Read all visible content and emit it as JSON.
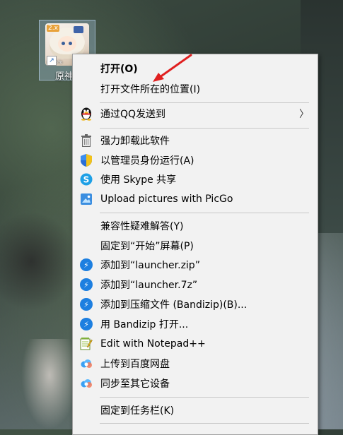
{
  "desktop": {
    "icon": {
      "label": "原神",
      "badge": "2.x",
      "brand": "miHoYo"
    }
  },
  "context_menu": {
    "items": [
      {
        "label": "打开(O)",
        "bold": true,
        "icon": "none"
      },
      {
        "label": "打开文件所在的位置(I)",
        "icon": "none"
      },
      {
        "label": "通过QQ发送到",
        "icon": "qq-penguin-icon",
        "submenu": true
      },
      {
        "label": "强力卸载此软件",
        "icon": "trash-icon"
      },
      {
        "label": "以管理员身份运行(A)",
        "icon": "uac-shield-icon"
      },
      {
        "label": "使用 Skype 共享",
        "icon": "skype-icon"
      },
      {
        "label": "Upload pictures with PicGo",
        "icon": "picgo-icon"
      },
      {
        "label": "兼容性疑难解答(Y)",
        "icon": "none"
      },
      {
        "label": "固定到“开始”屏幕(P)",
        "icon": "none"
      },
      {
        "label": "添加到“launcher.zip”",
        "icon": "bandizip-icon"
      },
      {
        "label": "添加到“launcher.7z”",
        "icon": "bandizip-icon"
      },
      {
        "label": "添加到压缩文件 (Bandizip)(B)...",
        "icon": "bandizip-icon"
      },
      {
        "label": "用 Bandizip 打开...",
        "icon": "bandizip-icon"
      },
      {
        "label": "Edit with Notepad++",
        "icon": "notepadpp-icon"
      },
      {
        "label": "上传到百度网盘",
        "icon": "baidu-netdisk-icon"
      },
      {
        "label": "同步至其它设备",
        "icon": "baidu-netdisk-icon"
      },
      {
        "label": "固定到任务栏(K)",
        "icon": "none"
      }
    ],
    "submenu_glyph": "〉"
  },
  "annotation": {
    "arrow_color": "#e02020"
  },
  "colors": {
    "menu_bg": "#f2f2f2",
    "bandizip_blue": "#1d7fe0",
    "skype_blue": "#1ea0e6"
  }
}
